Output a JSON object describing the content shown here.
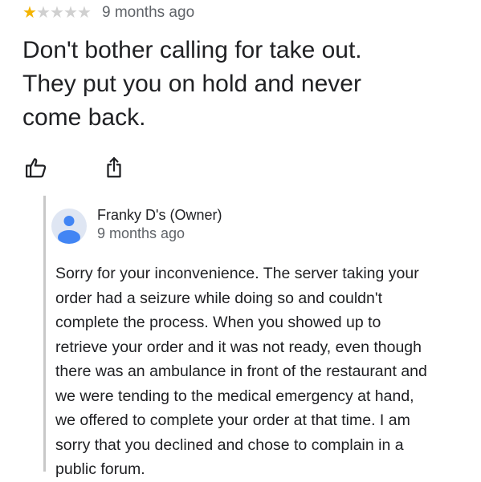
{
  "review": {
    "rating": 1,
    "rating_max": 5,
    "time": "9 months ago",
    "text_lines": [
      "Don't bother calling for take out.",
      "They put you on hold and never",
      "come back."
    ],
    "actions": {
      "like_icon": "thumbs-up-icon",
      "share_icon": "share-icon"
    },
    "star_color": "#f4b400"
  },
  "owner_response": {
    "name": "Franky D's (Owner)",
    "time": "9 months ago",
    "avatar_color": "#4285f4",
    "text_lines": [
      "Sorry for your inconvenience.  The server taking your",
      "order had a seizure while doing so and couldn't",
      "complete the process.  When you showed up to",
      "retrieve your order and it was not ready, even though",
      "there was an ambulance in front of the restaurant and",
      "we were tending to the medical emergency at hand,",
      "we offered to complete your order at that time.  I am",
      "sorry that you declined and chose to complain in a",
      "public forum."
    ]
  }
}
